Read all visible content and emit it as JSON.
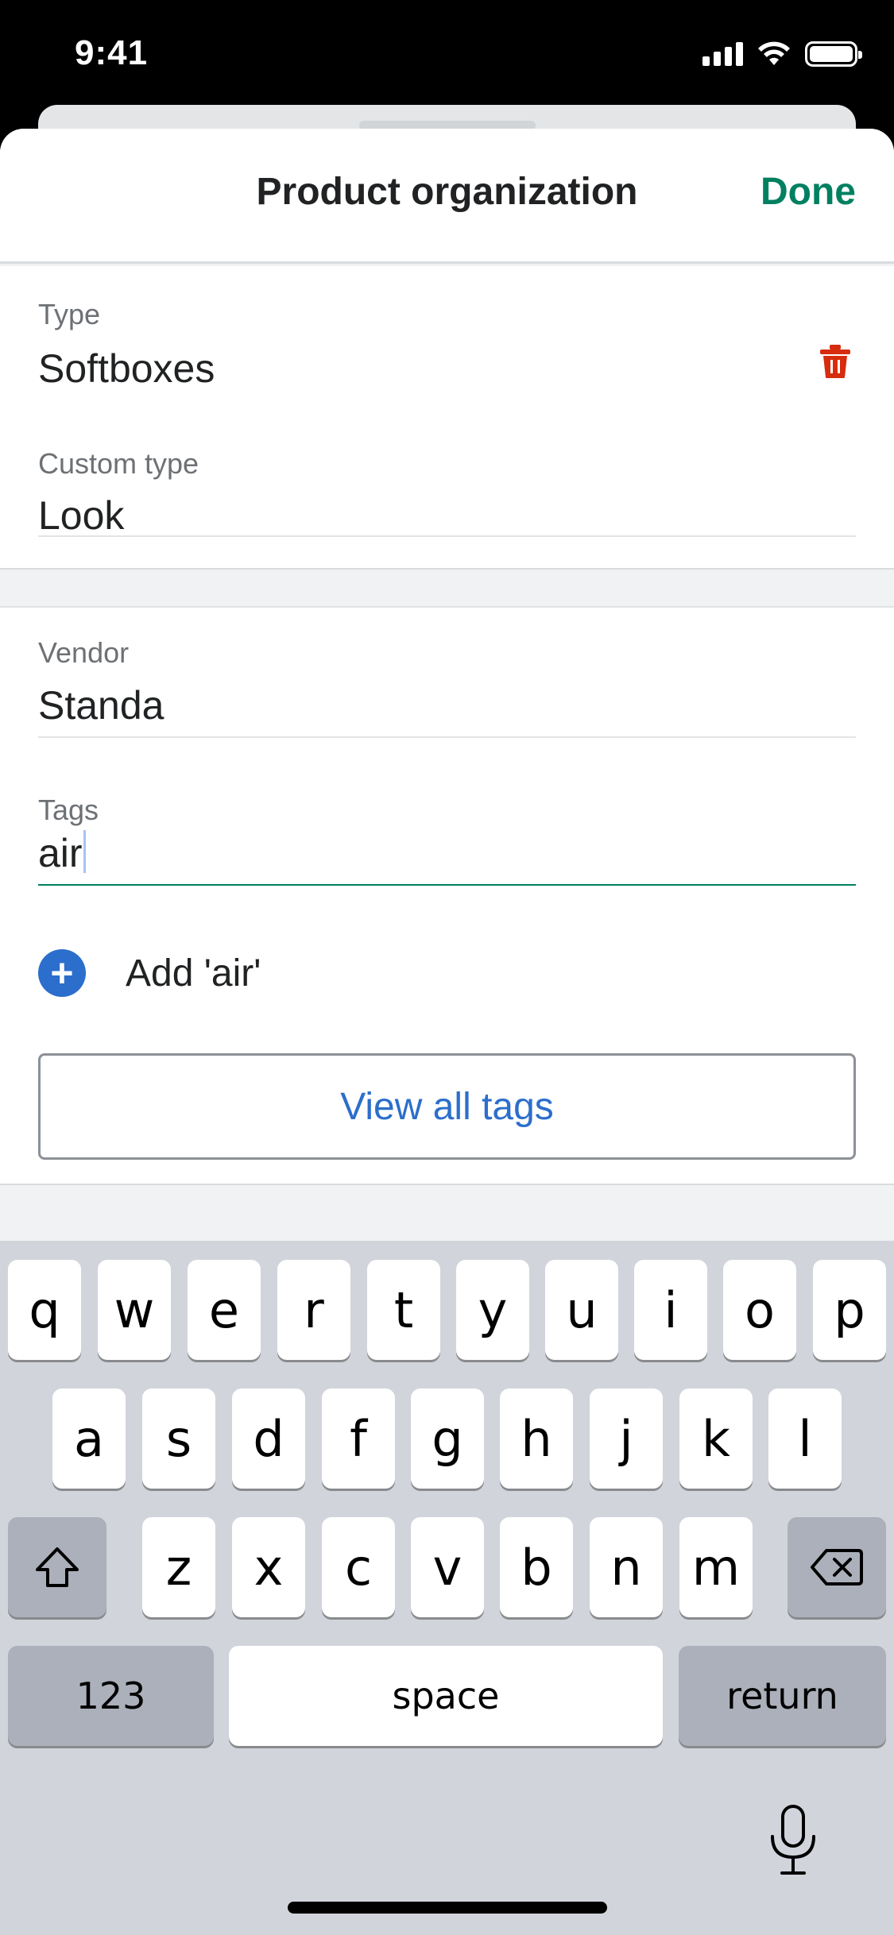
{
  "status_bar": {
    "time": "9:41"
  },
  "header": {
    "title": "Product organization",
    "done_label": "Done"
  },
  "fields": {
    "type": {
      "label": "Type",
      "value": "Softboxes"
    },
    "custom_type": {
      "label": "Custom type",
      "value": "Look"
    },
    "vendor": {
      "label": "Vendor",
      "value": "Standa"
    },
    "tags": {
      "label": "Tags",
      "value": "air"
    }
  },
  "add_tag_label": "Add 'air'",
  "view_all_label": "View all tags",
  "colors": {
    "accent_green": "#008060",
    "link_blue": "#2c6ecb",
    "delete_red": "#d72c0d"
  },
  "icons": [
    "trash-icon",
    "plus-circle-icon",
    "shift-icon",
    "delete-icon",
    "microphone-icon"
  ],
  "keyboard": {
    "row1": [
      "q",
      "w",
      "e",
      "r",
      "t",
      "y",
      "u",
      "i",
      "o",
      "p"
    ],
    "row2": [
      "a",
      "s",
      "d",
      "f",
      "g",
      "h",
      "j",
      "k",
      "l"
    ],
    "row3": [
      "z",
      "x",
      "c",
      "v",
      "b",
      "n",
      "m"
    ],
    "numbers_label": "123",
    "space_label": "space",
    "return_label": "return"
  }
}
